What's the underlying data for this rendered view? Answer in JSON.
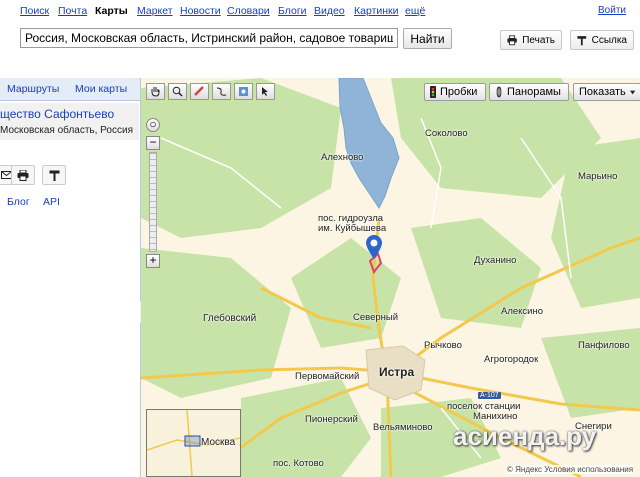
{
  "nav": {
    "items": [
      "Поиск",
      "Почта",
      "Карты",
      "Маркет",
      "Новости",
      "Словари",
      "Блоги",
      "Видео",
      "Картинки",
      "ещё"
    ],
    "active_index": 2,
    "login_label": "Войти"
  },
  "search": {
    "value": "Россия, Московская область, Истринский район, садовое товарищество",
    "button_label": "Найти"
  },
  "tools": {
    "print_label": "Печать",
    "link_label": "Ссылка"
  },
  "sidebar": {
    "tabs": [
      "Маршруты",
      "Мои карты"
    ],
    "result_title": "щество Сафонтьево",
    "result_subtitle": "Московская область, Россия",
    "links": [
      "Блог",
      "API"
    ]
  },
  "map": {
    "controls": {
      "traffic": "Пробки",
      "panoramas": "Панорамы",
      "show": "Показать"
    },
    "places": {
      "alekhnovo": "Алехново",
      "sokolovo": "Соколово",
      "marjino": "Марьино",
      "gidrouzla": "пос. гидроузла",
      "kuibysheva": "им. Куйбышева",
      "dukhanino": "Духанино",
      "glebovsky": "Глебовский",
      "severny": "Северный",
      "aleksino": "Алексино",
      "rychkovo": "Рычково",
      "panfilovo": "Панфилово",
      "agrogorodok": "Агрогородок",
      "pervomaisky": "Первомайский",
      "istra": "Истра",
      "poselok_stantsii": "поселок станции",
      "manikhino": "Манихино",
      "pionersky": "Пионерский",
      "velyaminovo": "Вельяминово",
      "snegiri": "Снегири",
      "kotovo": "пос. Котово",
      "moskva": "Москва"
    },
    "road_badge": "A-107",
    "watermark": "асиенда.ру",
    "copyright": "© Яндекс  Условия использования"
  }
}
